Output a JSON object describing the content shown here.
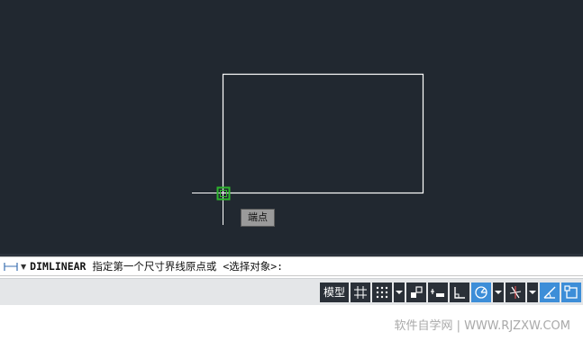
{
  "canvas": {
    "tooltip_text": "端点",
    "bg_color": "#212830",
    "line_color": "#ffffff",
    "snap_color": "#2db52d"
  },
  "command_line": {
    "command": "DIMLINEAR",
    "prompt": " 指定第一个尺寸界线原点或 <选择对象>:",
    "icon": "dimlinear-icon"
  },
  "status_bar": {
    "model_label": "模型",
    "buttons": [
      {
        "name": "grid-icon",
        "active": false
      },
      {
        "name": "snap-dots-icon",
        "active": false,
        "dropdown": true
      },
      {
        "name": "infer-constraints-icon",
        "active": false
      },
      {
        "name": "dynamic-input-icon",
        "active": false
      },
      {
        "name": "ortho-icon",
        "active": false
      },
      {
        "name": "polar-tracking-icon",
        "active": true,
        "dropdown": true
      },
      {
        "name": "isometric-icon",
        "active": false,
        "dropdown": true
      },
      {
        "name": "object-snap-tracking-icon",
        "active": true
      },
      {
        "name": "object-snap-icon",
        "active": true
      }
    ],
    "accent_color": "#3d8ed8"
  },
  "watermark": {
    "text": "软件自学网 | WWW.RJZXW.COM"
  }
}
